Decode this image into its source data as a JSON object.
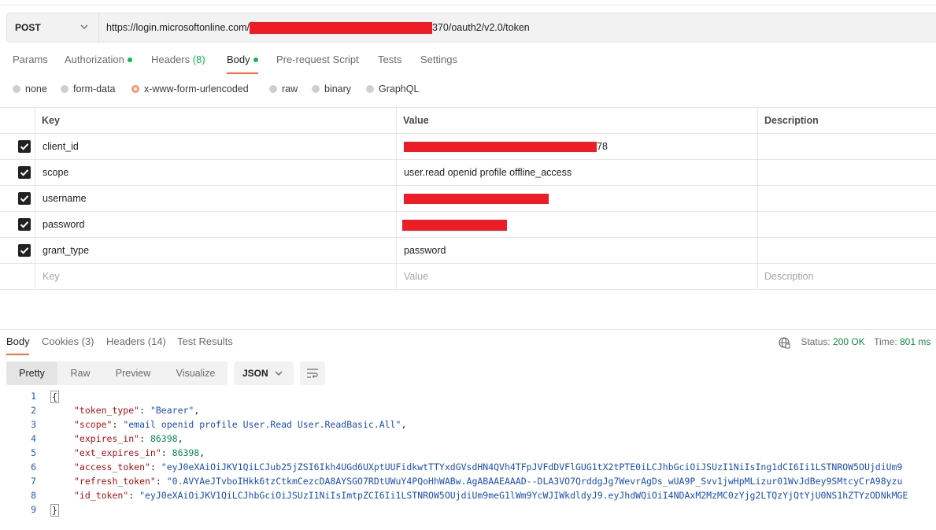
{
  "request": {
    "method": "POST",
    "url_prefix": "https://login.microsoftonline.com/",
    "url_suffix": "370/oauth2/v2.0/token"
  },
  "request_tabs": [
    {
      "label": "Params"
    },
    {
      "label": "Authorization"
    },
    {
      "label": "Headers",
      "count": "(8)"
    },
    {
      "label": "Body"
    },
    {
      "label": "Pre-request Script"
    },
    {
      "label": "Tests"
    },
    {
      "label": "Settings"
    }
  ],
  "body_types": [
    "none",
    "form-data",
    "x-www-form-urlencoded",
    "raw",
    "binary",
    "GraphQL"
  ],
  "selected_body_type": "x-www-form-urlencoded",
  "table": {
    "headers": {
      "key": "Key",
      "value": "Value",
      "description": "Description"
    },
    "rows": [
      {
        "key": "client_id",
        "value_suffix": "78"
      },
      {
        "key": "scope",
        "value": "user.read openid profile offline_access"
      },
      {
        "key": "username",
        "value": ""
      },
      {
        "key": "password",
        "value": ""
      },
      {
        "key": "grant_type",
        "value": "password"
      }
    ],
    "placeholders": {
      "key": "Key",
      "value": "Value",
      "description": "Description"
    }
  },
  "response_tabs": [
    {
      "label": "Body"
    },
    {
      "label": "Cookies",
      "count": "(3)"
    },
    {
      "label": "Headers",
      "count": "(14)"
    },
    {
      "label": "Test Results"
    }
  ],
  "status": {
    "status_label": "Status:",
    "status_value": "200 OK",
    "time_label": "Time:",
    "time_value": "801 ms"
  },
  "view_modes": [
    "Pretty",
    "Raw",
    "Preview",
    "Visualize"
  ],
  "format": "JSON",
  "icons": {
    "method_dropdown": "chevron-down-icon",
    "format_dropdown": "chevron-down-icon",
    "wrap": "wrap-lines-icon",
    "network": "globe-icon"
  },
  "colors": {
    "accent": "#ff6c37",
    "indicator": "#0cbb52",
    "redaction": "#ee1c25"
  },
  "code_lines": [
    {
      "n": "1",
      "text": "{"
    },
    {
      "n": "2",
      "key": "\"token_type\"",
      "value": "\"Bearer\"",
      "tail": ","
    },
    {
      "n": "3",
      "key": "\"scope\"",
      "value": "\"email openid profile User.Read User.ReadBasic.All\"",
      "tail": ","
    },
    {
      "n": "4",
      "key": "\"expires_in\"",
      "num": "86398",
      "tail": ","
    },
    {
      "n": "5",
      "key": "\"ext_expires_in\"",
      "num": "86398",
      "tail": ","
    },
    {
      "n": "6",
      "key": "\"access_token\"",
      "value": "\"eyJ0eXAiOiJKV1QiLCJub25jZSI6Ikh4UGd6UXptUUFidkwtTTYxdGVsdHN4QVh4TFpJVFdDVFlGUG1tX2tPTE0iLCJhbGciOiJSUzI1NiIsIng1dCI6Ii1LSTNROW5OUjdiUm9"
    },
    {
      "n": "7",
      "key": "\"refresh_token\"",
      "value": "\"0.AVYAeJTvboIHkk6tzCtkmCezcDA8AYSGO7RDtUWuY4PQoHhWABw.AgABAAEAAAD--DLA3VO7QrddgJg7WevrAgDs_wUA9P_Svv1jwHpMLizur01WvJdBey9SMtcyCrA98yzu"
    },
    {
      "n": "8",
      "key": "\"id_token\"",
      "value": "\"eyJ0eXAiOiJKV1QiLCJhbGciOiJSUzI1NiIsImtpZCI6Ii1LSTNROW5OUjdiUm9meG1lWm9YcWJIWkdldyJ9.eyJhdWQiOiI4NDAxM2MzMC0zYjg2LTQzYjQtYjU0NS1hZTYzODNkMGE"
    },
    {
      "n": "9",
      "text": "}"
    }
  ]
}
